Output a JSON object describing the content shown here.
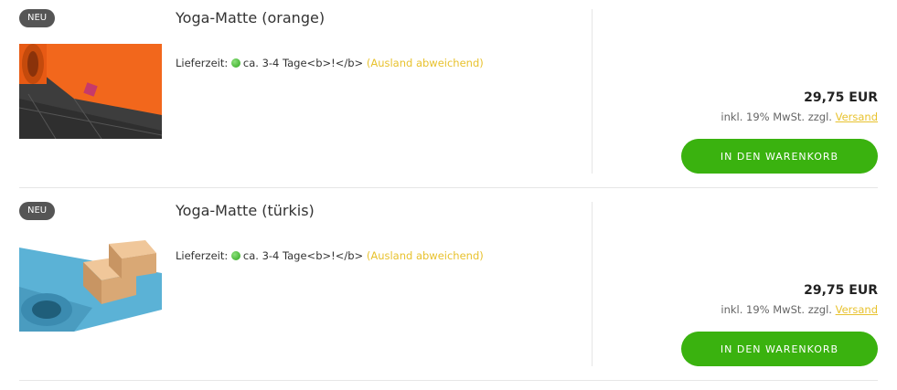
{
  "products": [
    {
      "badge": "NEU",
      "title": "Yoga-Matte (orange)",
      "image_icon": "orange-yoga-mat-image",
      "delivery_label": "Lieferzeit:",
      "delivery_time": "ca. 3-4 Tage<b>!</b>",
      "delivery_abroad": "(Ausland abweichend)",
      "price": "29,75 EUR",
      "tax_text": "inkl. 19% MwSt. zzgl.",
      "shipping_link": "Versand",
      "cart_button": "IN DEN WARENKORB"
    },
    {
      "badge": "NEU",
      "title": "Yoga-Matte (türkis)",
      "image_icon": "turquoise-yoga-mat-image",
      "delivery_label": "Lieferzeit:",
      "delivery_time": "ca. 3-4 Tage<b>!</b>",
      "delivery_abroad": "(Ausland abweichend)",
      "price": "29,75 EUR",
      "tax_text": "inkl. 19% MwSt. zzgl.",
      "shipping_link": "Versand",
      "cart_button": "IN DEN WARENKORB"
    }
  ],
  "colors": {
    "accent_green": "#3ab20f",
    "link_yellow": "#e8c22e",
    "badge_gray": "#555555"
  }
}
